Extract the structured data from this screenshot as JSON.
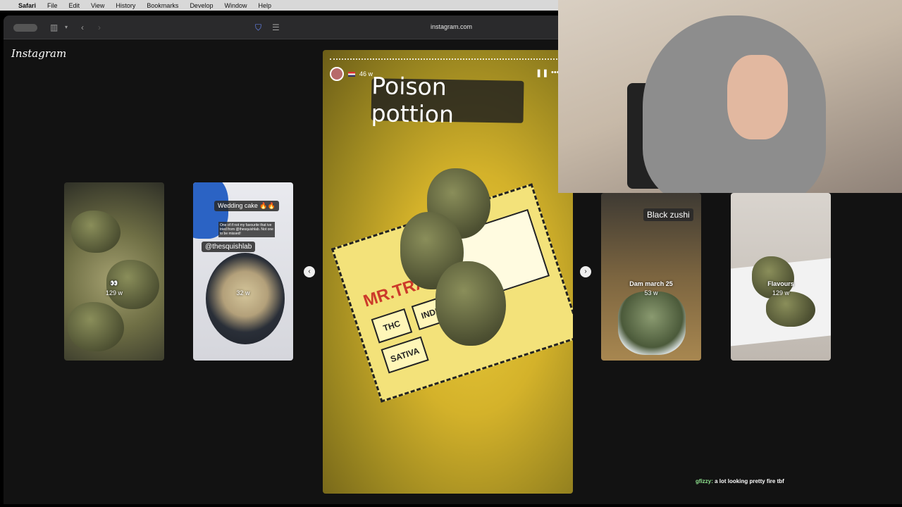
{
  "menubar": {
    "apple_icon": "apple-icon",
    "items": [
      "Safari",
      "File",
      "Edit",
      "View",
      "History",
      "Bookmarks",
      "Develop",
      "Window",
      "Help"
    ]
  },
  "browser": {
    "url": "instagram.com"
  },
  "instagram": {
    "logo": "Instagram"
  },
  "cards": [
    {
      "emoji": "👀",
      "age": "129 w"
    },
    {
      "sticker_title": "Wedding cake 🔥🔥",
      "mention": "@thesquishlab",
      "small_text": "One of if not my favourite that ive tried from @thesquishlab. Not one to be missed!",
      "age": "32 w"
    },
    {
      "sticker_title": "Black zushi",
      "caption": "Dam march 25",
      "age": "53 w"
    },
    {
      "caption": "Flavours",
      "age": "129 w"
    }
  ],
  "main_story": {
    "age": "46 w",
    "title": "Poison pottion",
    "label_brand": "MR.TRAP",
    "label_thc": "THC",
    "label_indica": "INDICA",
    "label_sativa": "SATIVA"
  },
  "chat": {
    "user": "gfizzy:",
    "message": "a lot looking pretty fire tbf"
  }
}
